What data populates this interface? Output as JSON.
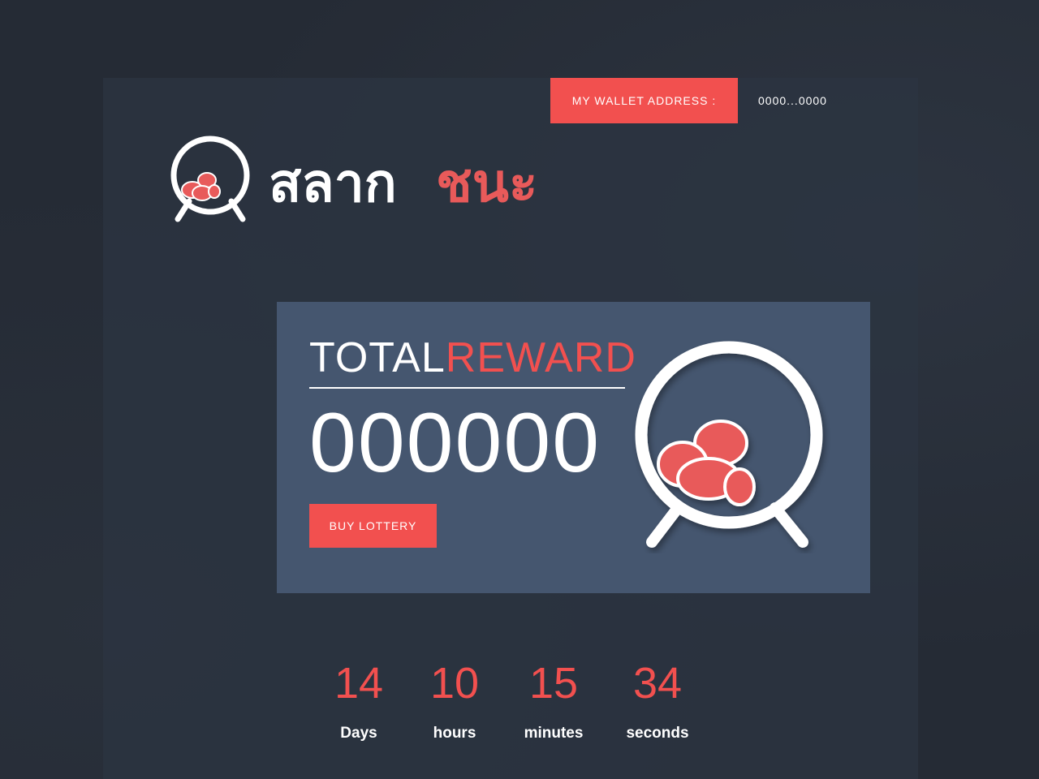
{
  "header": {
    "wallet_button_label": "MY WALLET ADDRESS :",
    "wallet_address": "0000...0000"
  },
  "logo": {
    "text_white": "สลาก",
    "text_red": "ชนะ",
    "icon": "lottery-ball-cage-icon"
  },
  "reward": {
    "title_part1": "TOTAL",
    "title_part2": "REWARD",
    "amount": "000000",
    "buy_button_label": "BUY LOTTERY",
    "icon": "lottery-ball-cage-icon"
  },
  "countdown": [
    {
      "value": "14",
      "label": "Days"
    },
    {
      "value": "10",
      "label": "hours"
    },
    {
      "value": "15",
      "label": "minutes"
    },
    {
      "value": "34",
      "label": "seconds"
    }
  ],
  "colors": {
    "accent": "#f2504f",
    "card": "#45566f",
    "background": "#252b35",
    "text": "#ffffff"
  }
}
